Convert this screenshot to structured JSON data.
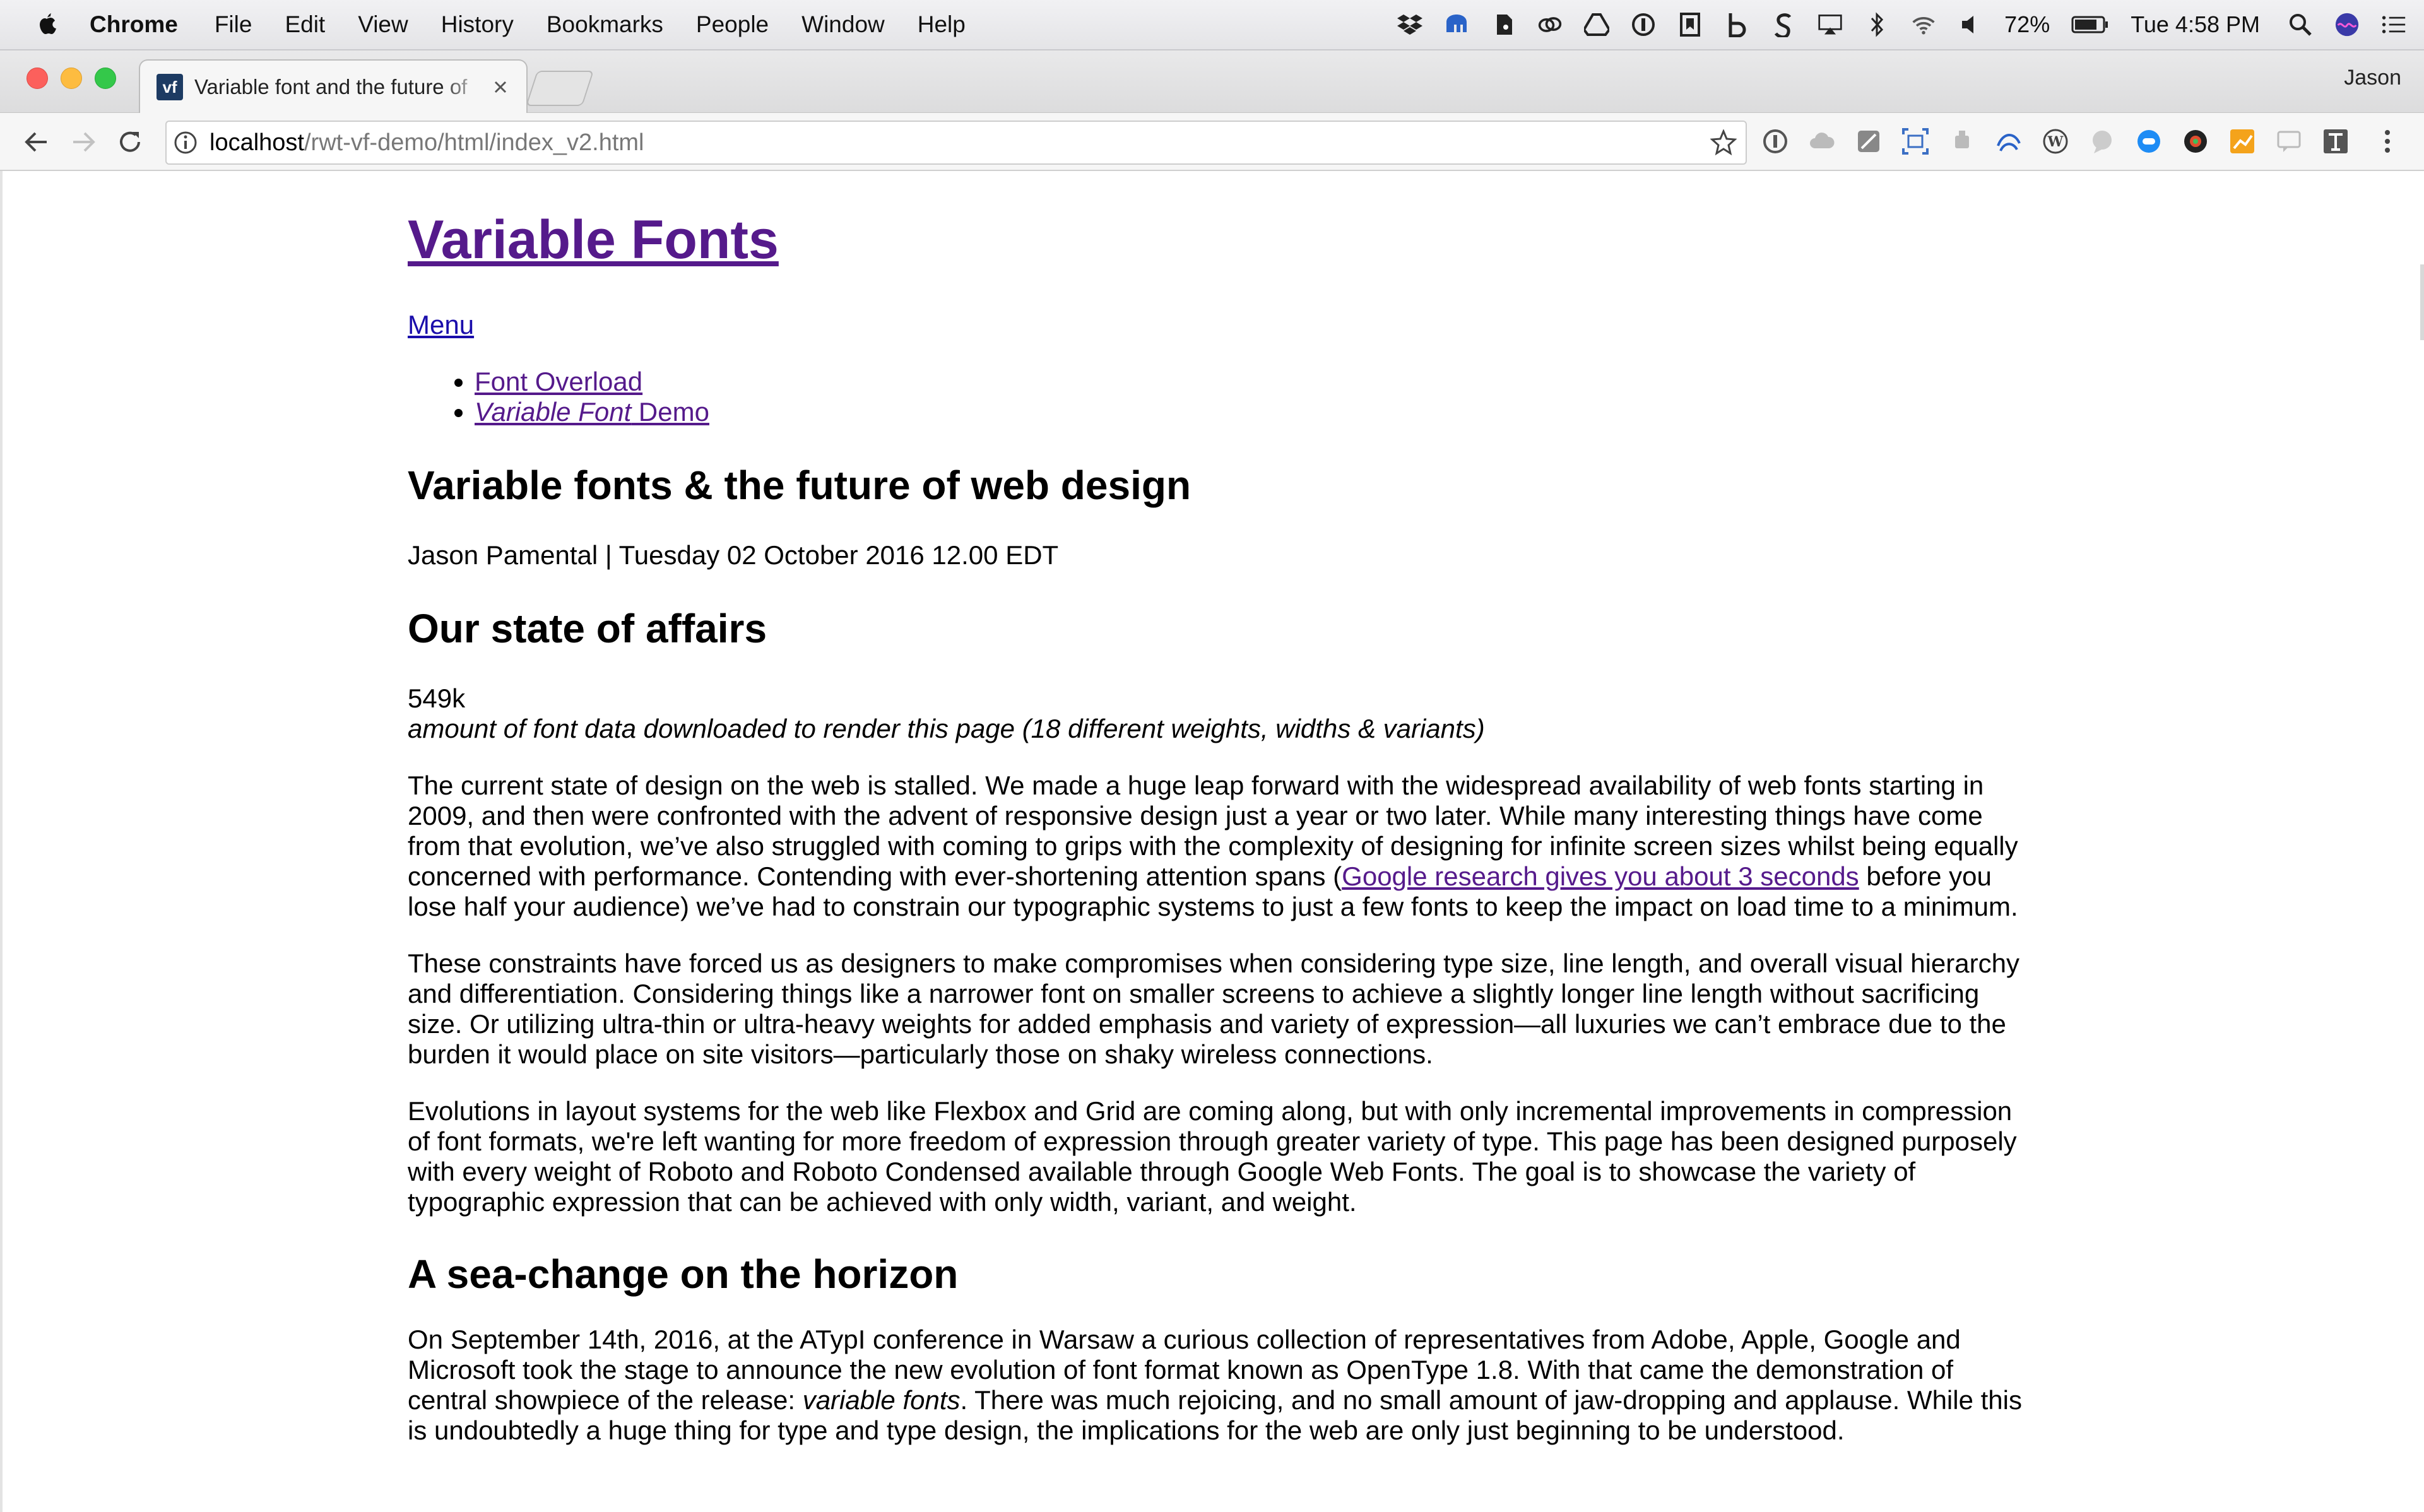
{
  "menubar": {
    "app_name": "Chrome",
    "items": [
      "File",
      "Edit",
      "View",
      "History",
      "Bookmarks",
      "People",
      "Window",
      "Help"
    ],
    "battery": "72%",
    "clock": "Tue 4:58 PM"
  },
  "browser": {
    "tab_title": "Variable font and the future of",
    "favicon_text": "vf",
    "profile_name": "Jason",
    "url_host": "localhost",
    "url_path": "/rwt-vf-demo/html/index_v2.html"
  },
  "page": {
    "site_title": "Variable Fonts",
    "menu_label": "Menu",
    "nav": [
      {
        "label": "Font Overload"
      },
      {
        "label_em": "Variable Font",
        "label_rest": " Demo"
      }
    ],
    "article_title": "Variable fonts & the future of web design",
    "byline": "Jason Pamental | Tuesday 02 October 2016 12.00 EDT",
    "section1_heading": "Our state of affairs",
    "stat_value": "549k",
    "stat_caption": "amount of font data downloaded to render this page (18 different weights, widths & variants)",
    "p1_before_link": "The current state of design on the web is stalled. We made a huge leap forward with the widespread availability of web fonts starting in 2009, and then were confronted with the advent of responsive design just a year or two later. While many interesting things have come from that evolution, we’ve also struggled with coming to grips with the complexity of designing for infinite screen sizes whilst being equally concerned with performance. Contending with ever-shortening attention spans (",
    "p1_link": "Google research gives you about 3 seconds",
    "p1_after_link": " before you lose half your audience) we’ve had to constrain our typographic systems to just a few fonts to keep the impact on load time to a minimum.",
    "p2": "These constraints have forced us as designers to make compromises when considering type size, line length, and overall visual hierarchy and differentiation. Considering things like a narrower font on smaller screens to achieve a slightly longer line length without sacrificing size. Or utilizing ultra-thin or ultra-heavy weights for added emphasis and variety of expression—all luxuries we can’t embrace due to the burden it would place on site visitors—particularly those on shaky wireless connections.",
    "p3": "Evolutions in layout systems for the web like Flexbox and Grid are coming along, but with only incremental improvements in compression of font formats, we're left wanting for more freedom of expression through greater variety of type. This page has been designed purposely with every weight of Roboto and Roboto Condensed available through Google Web Fonts. The goal is to showcase the variety of typographic expression that can be achieved with only width, variant, and weight.",
    "section2_heading": "A sea-change on the horizon",
    "p4_before_em": "On September 14th, 2016, at the ATypI conference in Warsaw a curious collection of representatives from Adobe, Apple, Google and Microsoft took the stage to announce the new evolution of font format known as OpenType 1.8. With that came the demonstration of central showpiece of the release: ",
    "p4_em": "variable fonts",
    "p4_after_em": ". There was much rejoicing, and no small amount of jaw-dropping and applause. While this is undoubtedly a huge thing for type and type design, the implications for the web are only just beginning to be understood."
  },
  "colors": {
    "link": "#1a0dab",
    "visited": "#551a8b"
  }
}
